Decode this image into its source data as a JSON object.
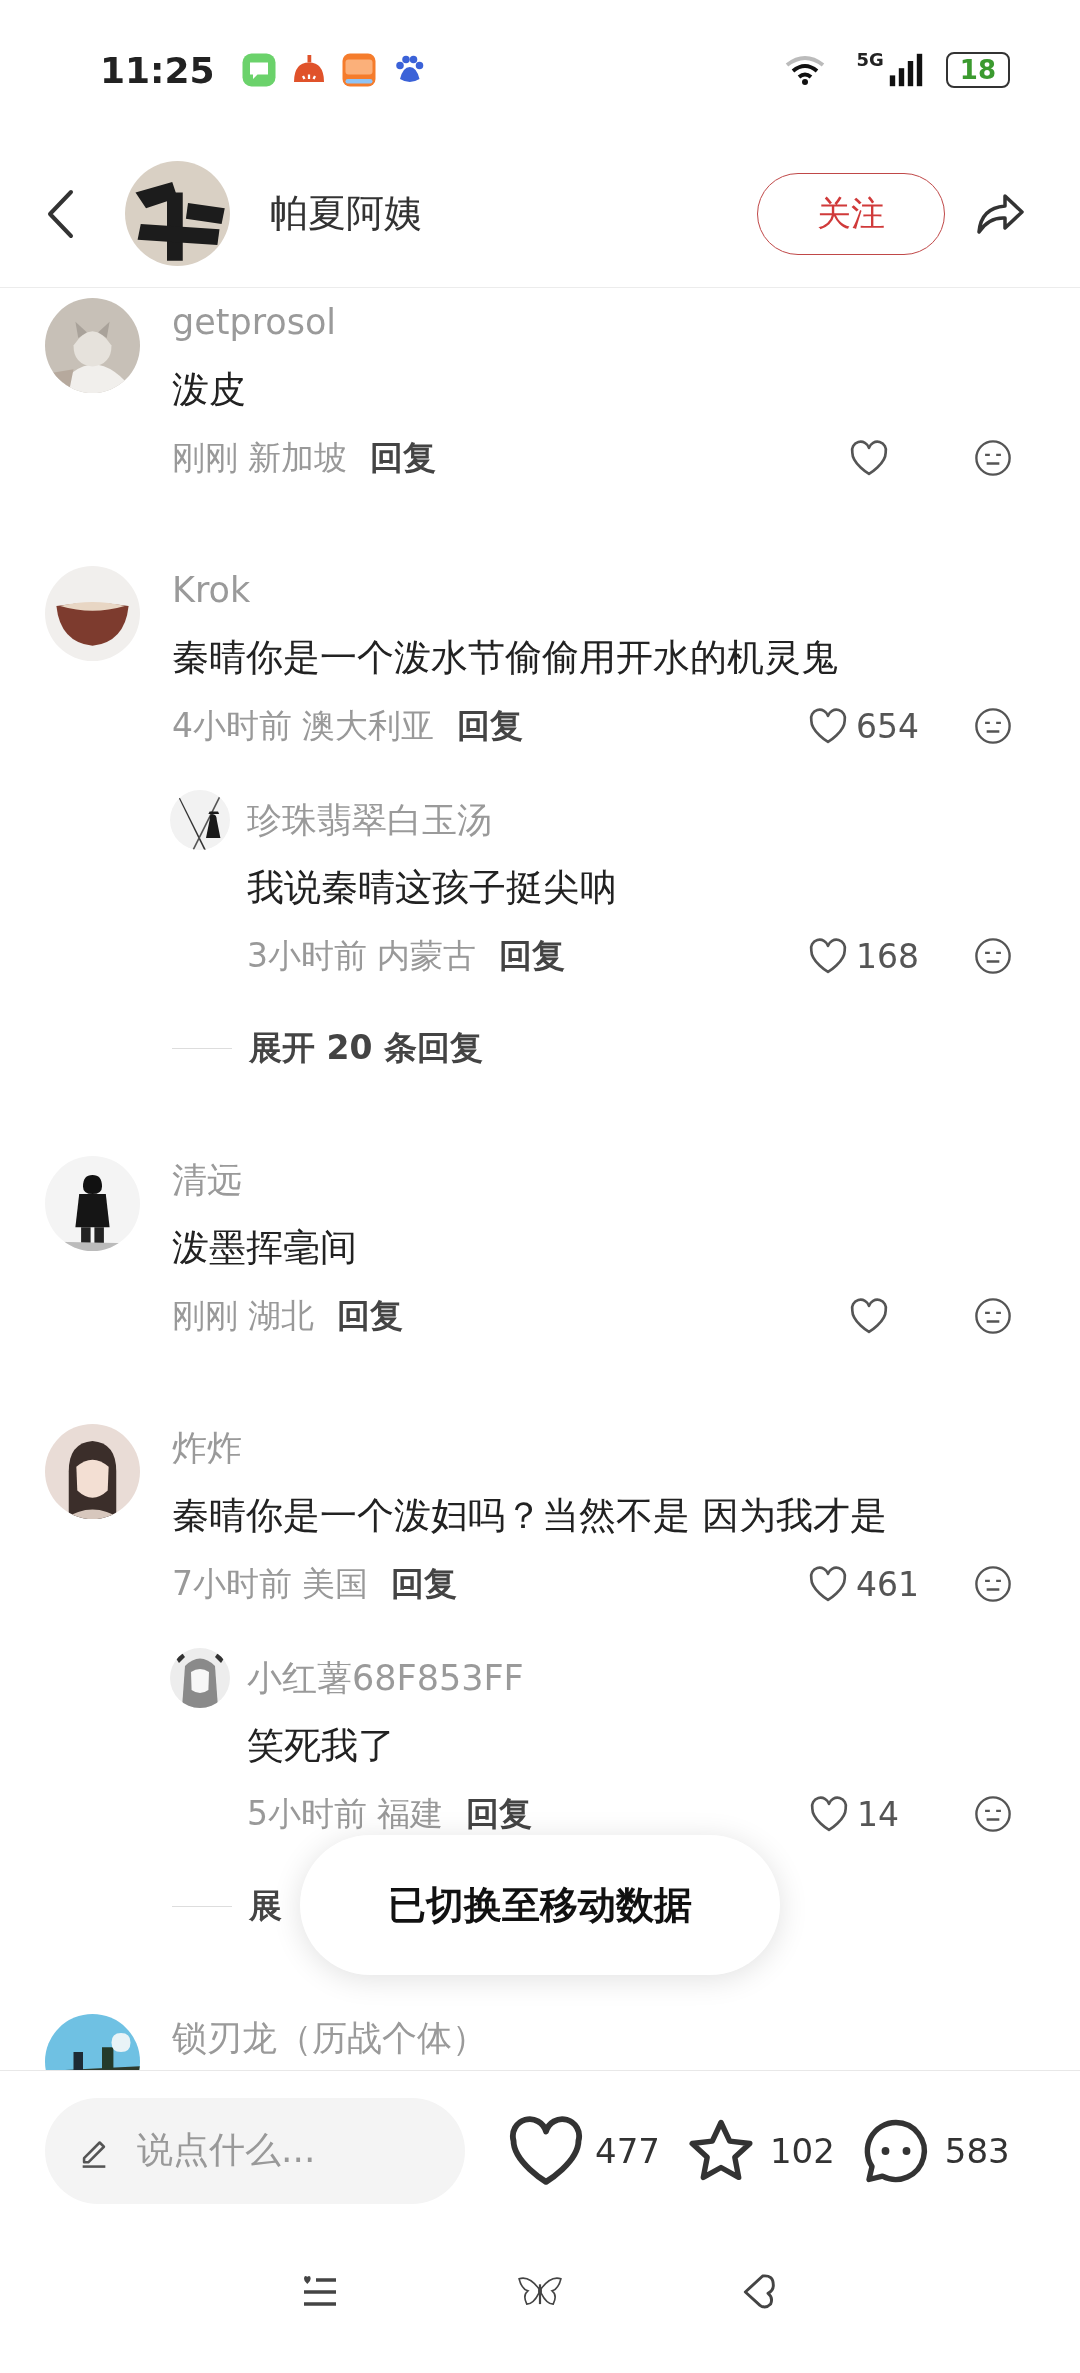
{
  "status_bar": {
    "time": "11:25",
    "network": "5G",
    "battery": "18"
  },
  "header": {
    "author": "帕夏阿姨",
    "follow": "关注"
  },
  "comments": [
    {
      "user": "getprosol",
      "text": "泼皮",
      "time": "刚刚",
      "location": "新加坡",
      "reply": "回复"
    },
    {
      "user": "Krok",
      "text": "秦晴你是一个泼水节偷偷用开水的机灵鬼",
      "time": "4小时前",
      "location": "澳大利亚",
      "reply": "回复",
      "likes": "654",
      "replies": [
        {
          "user": "珍珠翡翠白玉汤",
          "text": "我说秦晴这孩子挺尖呐",
          "time": "3小时前",
          "location": "内蒙古",
          "reply": "回复",
          "likes": "168"
        }
      ],
      "expand": "展开 20 条回复"
    },
    {
      "user": "清远",
      "text": "泼墨挥毫间",
      "time": "刚刚",
      "location": "湖北",
      "reply": "回复"
    },
    {
      "user": "炸炸",
      "text": "秦晴你是一个泼妇吗？当然不是 因为我才是",
      "time": "7小时前",
      "location": "美国",
      "reply": "回复",
      "likes": "461",
      "replies": [
        {
          "user": "小红薯68F853FF",
          "text": "笑死我了",
          "time": "5小时前",
          "location": "福建",
          "reply": "回复",
          "likes": "14"
        }
      ],
      "expand": "展"
    },
    {
      "user": "锁刃龙（历战个体）"
    }
  ],
  "toast": "已切换至移动数据",
  "composer": {
    "placeholder": "说点什么..."
  },
  "actions": [
    {
      "kind": "like",
      "count": "477"
    },
    {
      "kind": "star",
      "count": "102"
    },
    {
      "kind": "comment",
      "count": "583"
    }
  ],
  "nav": [
    {
      "kind": "list"
    },
    {
      "kind": "butterfly"
    },
    {
      "kind": "heart"
    }
  ]
}
